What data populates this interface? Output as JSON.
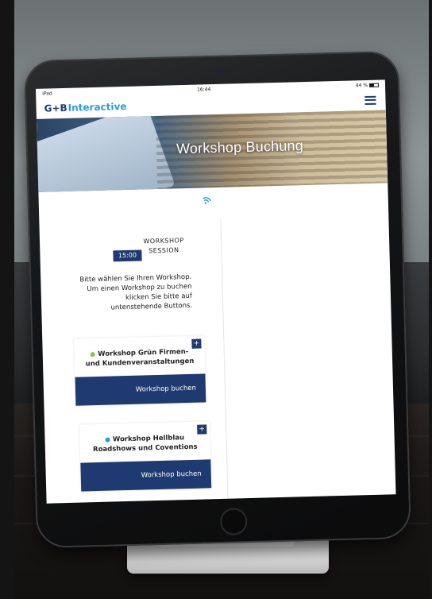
{
  "status": {
    "device": "iPad",
    "time": "16:44",
    "battery": "44 %"
  },
  "brand": {
    "logo_main": "G+B",
    "logo_word": "Interactive"
  },
  "hero": {
    "title": "Workshop Buchung"
  },
  "session": {
    "label": "WORKSHOP SESSION",
    "time": "15:00"
  },
  "intro": {
    "text": "Bitte wählen Sie Ihren Workshop. Um einen Workshop zu buchen klicken Sie bitte auf untenstehende Buttons."
  },
  "workshops": [
    {
      "name": "Workshop Grün Firmen- und Kundenveranstaltungen",
      "dot_color": "#8bc34a",
      "button": "Workshop buchen",
      "plus": "+"
    },
    {
      "name": "Workshop Hellblau Roadshows und Coventions",
      "dot_color": "#2b9bd6",
      "button": "Workshop buchen",
      "plus": "+"
    }
  ],
  "colors": {
    "brand_navy": "#1e3a70",
    "brand_blue": "#2b9bd6"
  },
  "icons": {
    "menu": "hamburger-menu-icon",
    "wifi": "wifi-icon"
  }
}
